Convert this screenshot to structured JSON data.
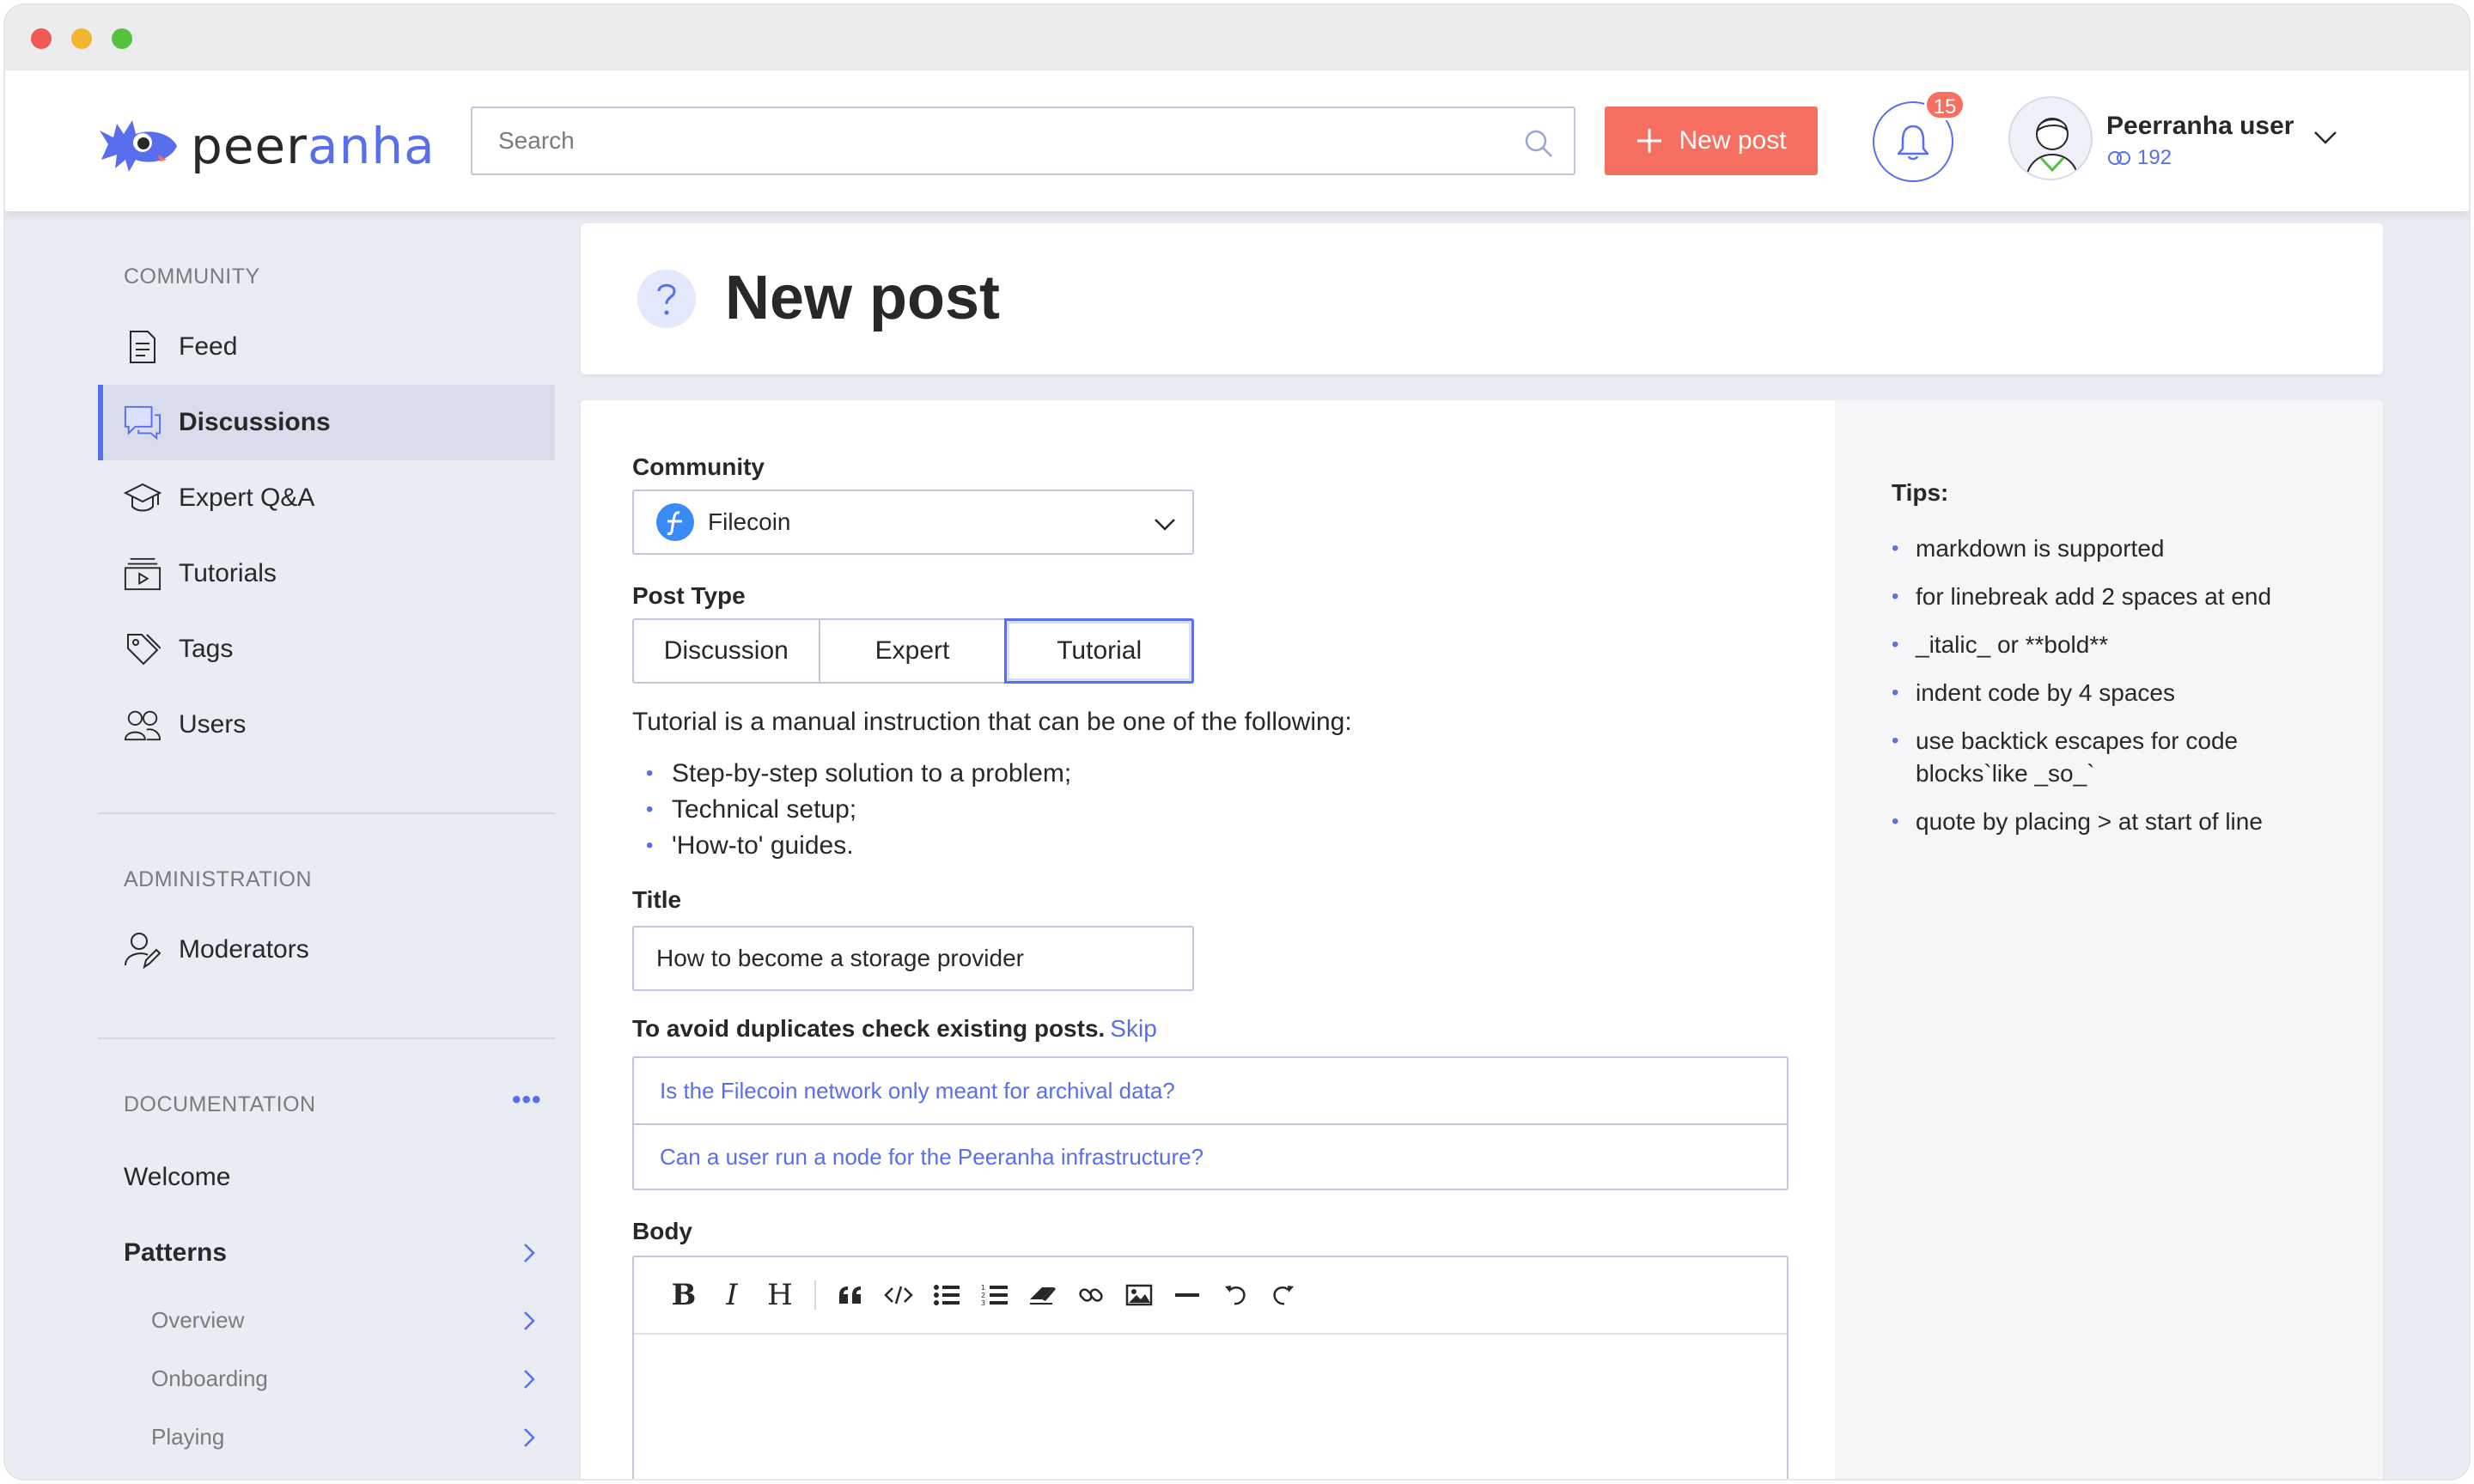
{
  "brand": {
    "logo_text_a": "peer",
    "logo_text_b": "anha",
    "accent": "#576fed",
    "cta": "#f76f60"
  },
  "header": {
    "search_placeholder": "Search",
    "new_post_label": "New post",
    "notifications_count": "15",
    "user_name": "Peerranha user",
    "user_rating": "192"
  },
  "sidebar": {
    "community_heading": "COMMUNITY",
    "items": [
      {
        "label": "Feed",
        "icon": "document-icon"
      },
      {
        "label": "Discussions",
        "icon": "chat-icon"
      },
      {
        "label": "Expert Q&A",
        "icon": "graduation-cap-icon"
      },
      {
        "label": "Tutorials",
        "icon": "video-icon"
      },
      {
        "label": "Tags",
        "icon": "tag-icon"
      },
      {
        "label": "Users",
        "icon": "users-icon"
      }
    ],
    "active_item": "Discussions",
    "admin_heading": "ADMINISTRATION",
    "admin_items": [
      {
        "label": "Moderators",
        "icon": "moderator-icon"
      }
    ],
    "doc_heading": "DOCUMENTATION",
    "doc_more": "•••",
    "doc_items": [
      {
        "label": "Welcome"
      },
      {
        "label": "Patterns"
      }
    ],
    "doc_subitems": [
      {
        "label": "Overview"
      },
      {
        "label": "Onboarding"
      },
      {
        "label": "Playing"
      }
    ]
  },
  "page": {
    "title": "New post"
  },
  "form": {
    "community_label": "Community",
    "community_value": "Filecoin",
    "post_type_label": "Post Type",
    "post_types": [
      "Discussion",
      "Expert",
      "Tutorial"
    ],
    "post_type_selected": "Tutorial",
    "post_type_description": "Tutorial is a manual instruction that can be one of the following:",
    "post_type_bullets": [
      "Step-by-step solution to a problem;",
      "Technical setup;",
      "'How-to' guides."
    ],
    "title_label": "Title",
    "title_value": "How to become a storage provider",
    "duplicates_text": "To avoid duplicates check existing posts.",
    "skip_label": "Skip",
    "duplicates": [
      "Is the Filecoin network only meant for archival data?",
      "Can a user run a node for the Peeranha infrastructure?"
    ],
    "body_label": "Body",
    "toolbar": {
      "bold": "B",
      "italic": "I",
      "heading": "H",
      "icons": [
        "quote-icon",
        "code-icon",
        "bullet-list-icon",
        "numbered-list-icon",
        "eraser-icon",
        "link-icon",
        "image-icon",
        "horizontal-rule-icon",
        "undo-icon",
        "redo-icon"
      ]
    }
  },
  "tips": {
    "title": "Tips:",
    "items": [
      "markdown is supported",
      "for linebreak add 2 spaces at end",
      "_italic_ or **bold**",
      "indent code by 4 spaces",
      "use backtick escapes for code blocks`like _so_`",
      "quote by placing > at start of line"
    ]
  }
}
